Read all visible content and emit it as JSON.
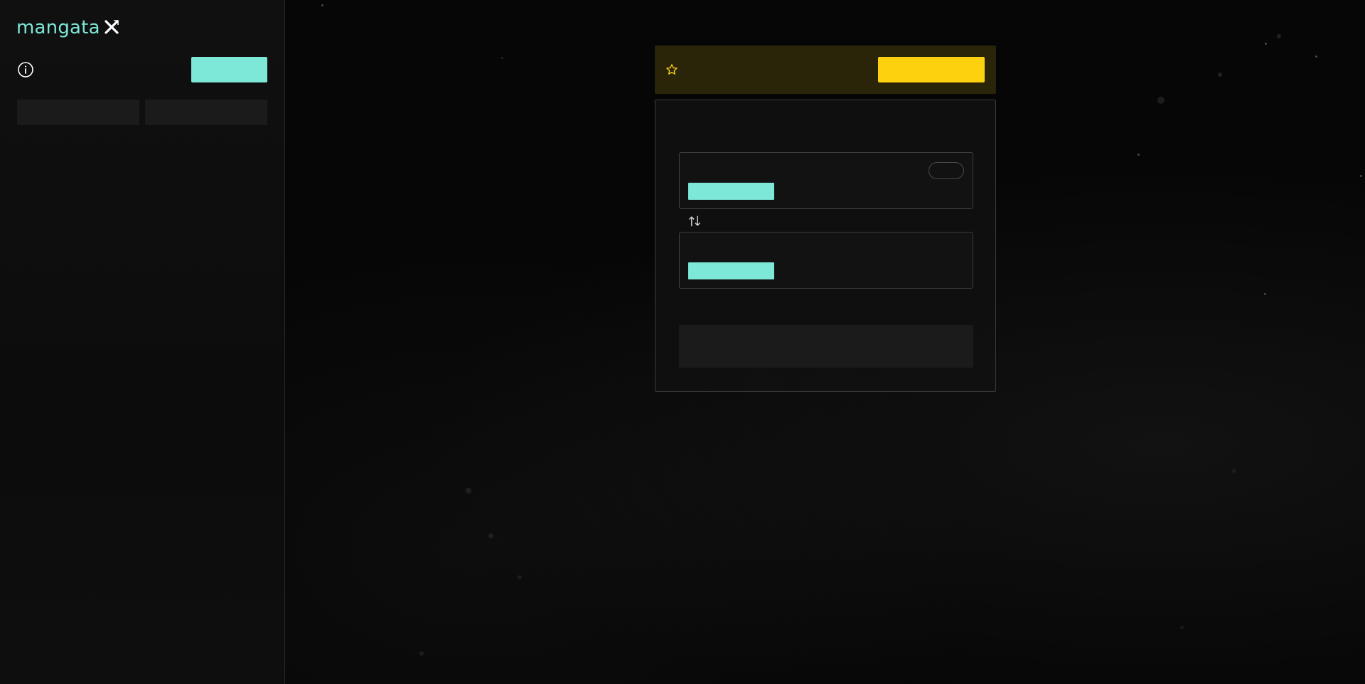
{
  "app": {
    "brand": "mangata",
    "accent_color": "#7de8d8",
    "banner_color": "#fdd10e"
  },
  "sidebar": {
    "connect_label": "",
    "tabs": [
      {
        "label": ""
      },
      {
        "label": ""
      }
    ]
  },
  "banner": {
    "text": "",
    "button_label": ""
  },
  "swap": {
    "title": "",
    "from": {
      "label": "",
      "max_label": "",
      "token_label": "",
      "amount_placeholder": ""
    },
    "to": {
      "label": "",
      "token_label": "",
      "amount_placeholder": ""
    },
    "submit_label": ""
  },
  "icons": {
    "logo_mark": "crossed-sword-icon",
    "info": "info-icon",
    "star": "star-icon",
    "swap": "swap-arrows-icon"
  }
}
